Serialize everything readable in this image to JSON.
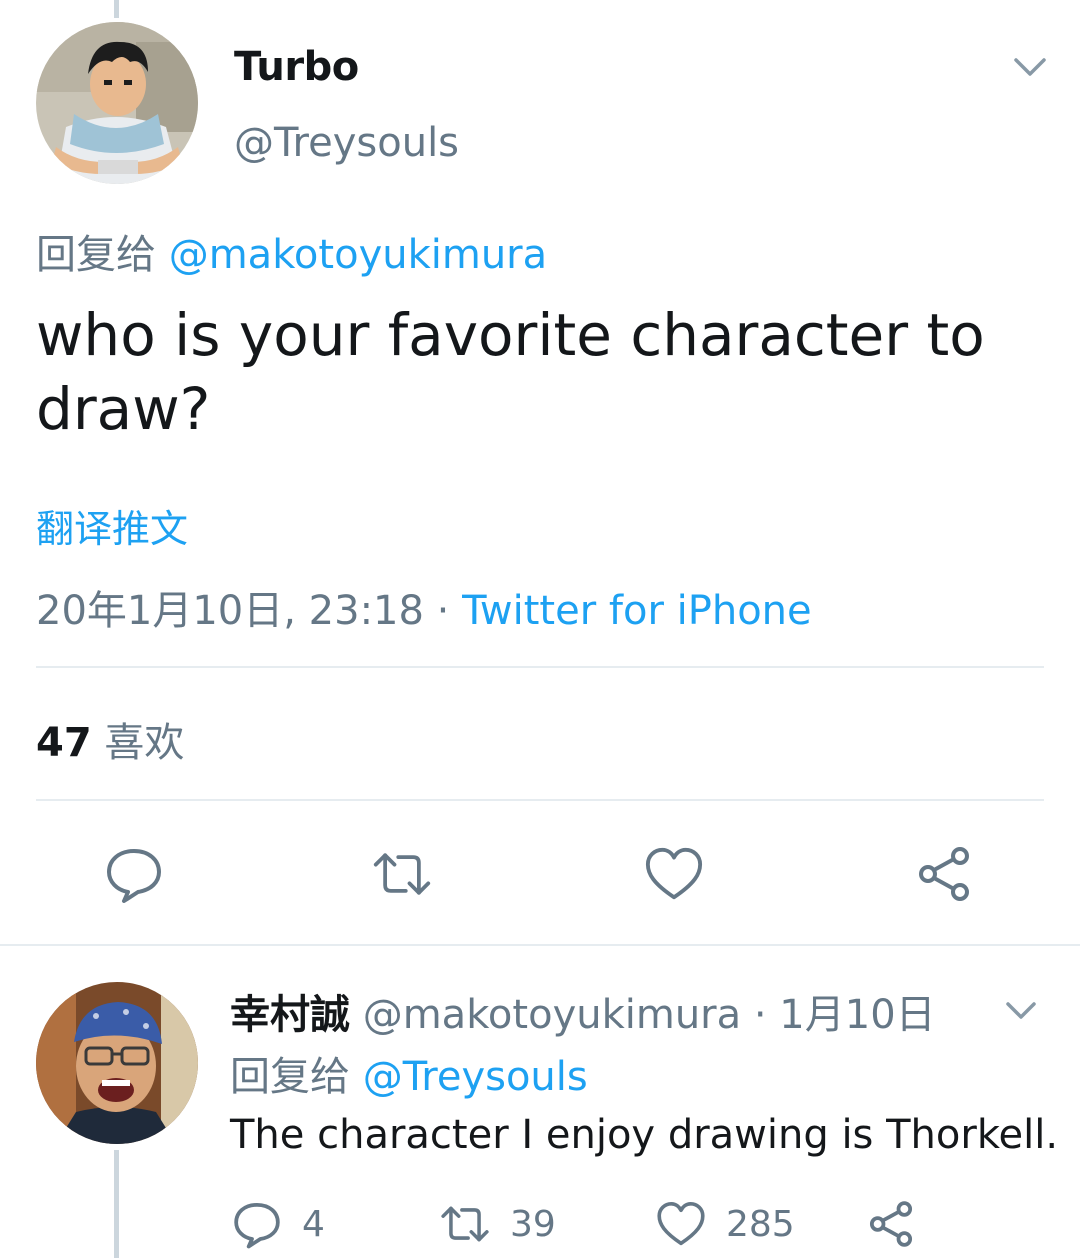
{
  "tweet": {
    "author_name": "Turbo",
    "author_handle": "@Treysouls",
    "reply_prefix": "回复给",
    "reply_mention": "@makotoyukimura",
    "text": "who is your favorite character to draw?",
    "translate_label": "翻译推文",
    "timestamp": "20年1月10日, 23:18",
    "separator": " · ",
    "source": "Twitter for iPhone",
    "likes_count": "47",
    "likes_label": "喜欢",
    "icons": {
      "reply": "comment-icon",
      "retweet": "retweet-icon",
      "like": "heart-icon",
      "share": "share-icon",
      "menu": "chevron-down-icon"
    }
  },
  "reply": {
    "author_name": "幸村誠",
    "author_handle": "@makotoyukimura",
    "separator": " · ",
    "date": "1月10日",
    "reply_prefix": "回复给",
    "reply_mention": "@Treysouls",
    "text": "The character I enjoy drawing is Thorkell.",
    "reply_count": "4",
    "retweet_count": "39",
    "like_count": "285"
  },
  "colors": {
    "accent": "#1da1f2",
    "text": "#14171a",
    "muted": "#657786",
    "divider": "#e6ecf0"
  }
}
